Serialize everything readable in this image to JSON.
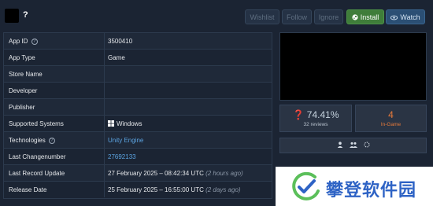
{
  "header": {
    "app_name": "?",
    "buttons": {
      "wishlist": "Wishlist",
      "follow": "Follow",
      "ignore": "Ignore",
      "install": "Install",
      "watch": "Watch"
    }
  },
  "info": {
    "rows": [
      {
        "label": "App ID",
        "help": true,
        "value": "3500410"
      },
      {
        "label": "App Type",
        "value": "Game"
      },
      {
        "label": "Store Name",
        "value": ""
      },
      {
        "label": "Developer",
        "value": ""
      },
      {
        "label": "Publisher",
        "value": ""
      },
      {
        "label": "Supported Systems",
        "value": "Windows"
      },
      {
        "label": "Technologies",
        "help": true,
        "value": "Unity Engine"
      },
      {
        "label": "Last Changenumber",
        "value": "27692133"
      },
      {
        "label": "Last Record Update",
        "value": "27 February 2025 – 08:42:34 UTC",
        "note": "(2 hours ago)"
      },
      {
        "label": "Release Date",
        "value": "25 February 2025 – 16:55:00 UTC",
        "note": "(2 days ago)"
      }
    ]
  },
  "stats": {
    "reviews": {
      "percent": "74.41%",
      "label": "32 reviews"
    },
    "ingame": {
      "count": "4",
      "label": "In-Game"
    }
  },
  "watermark": {
    "text": "攀登软件园"
  },
  "colors": {
    "install": "#3f7d3a",
    "watch": "#2b4f74",
    "link": "#5ba3e0",
    "ingame": "#e87a3a"
  }
}
